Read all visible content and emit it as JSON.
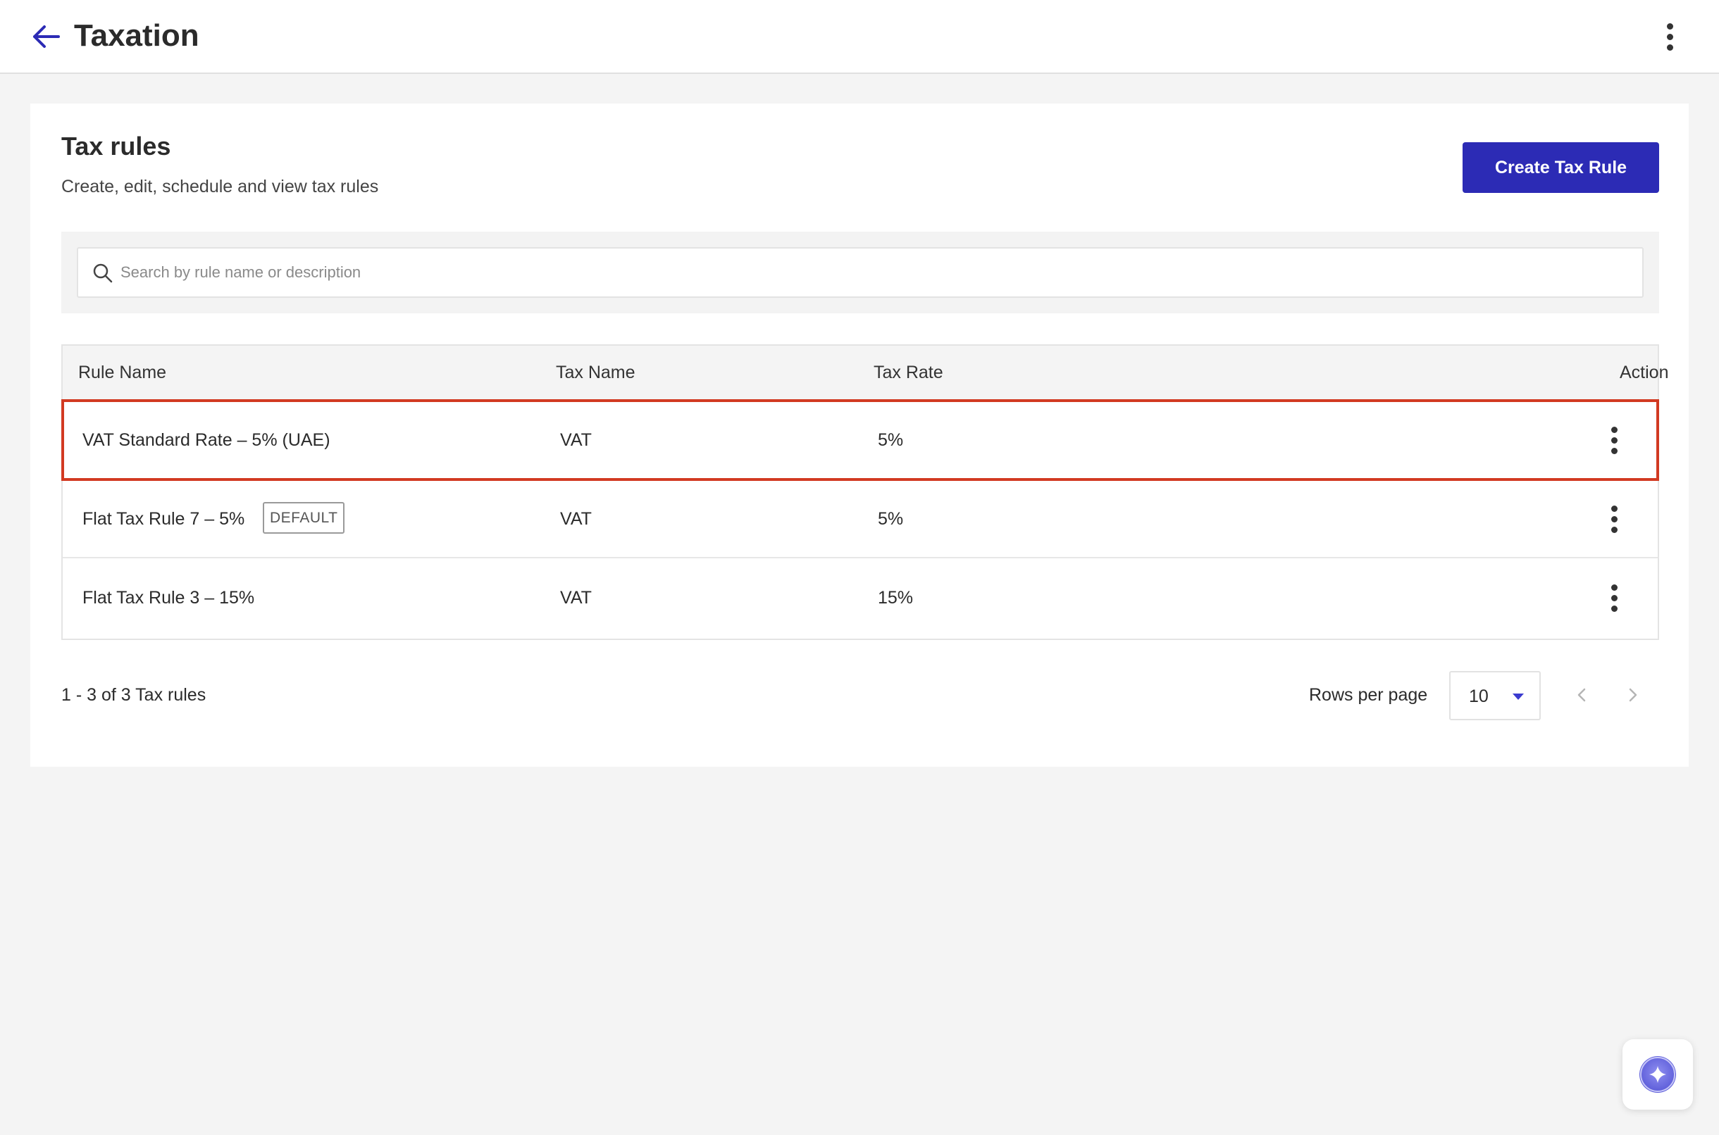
{
  "header": {
    "title": "Taxation",
    "back_icon": "arrow-left-icon",
    "more_icon": "more-vertical-icon"
  },
  "section": {
    "title": "Tax rules",
    "subtitle": "Create, edit, schedule and view tax rules",
    "create_button_label": "Create Tax Rule"
  },
  "search": {
    "placeholder": "Search by rule name or description",
    "value": ""
  },
  "table": {
    "columns": [
      "Rule Name",
      "Tax Name",
      "Tax Rate",
      "Action"
    ],
    "rows": [
      {
        "rule_name": "VAT Standard Rate – 5% (UAE)",
        "badge": "",
        "tax_name": "VAT",
        "tax_rate": "5%",
        "highlighted": true
      },
      {
        "rule_name": "Flat Tax Rule 7 – 5%",
        "badge": "DEFAULT",
        "tax_name": "VAT",
        "tax_rate": "5%",
        "highlighted": false
      },
      {
        "rule_name": "Flat Tax Rule 3 – 15%",
        "badge": "",
        "tax_name": "VAT",
        "tax_rate": "15%",
        "highlighted": false
      }
    ]
  },
  "pagination": {
    "summary": "1 - 3 of 3 Tax rules",
    "rows_per_page_label": "Rows per page",
    "rows_per_page_value": "10"
  },
  "colors": {
    "primary": "#2c2bb5",
    "highlight_border": "#d23a22",
    "background": "#f4f4f4"
  }
}
